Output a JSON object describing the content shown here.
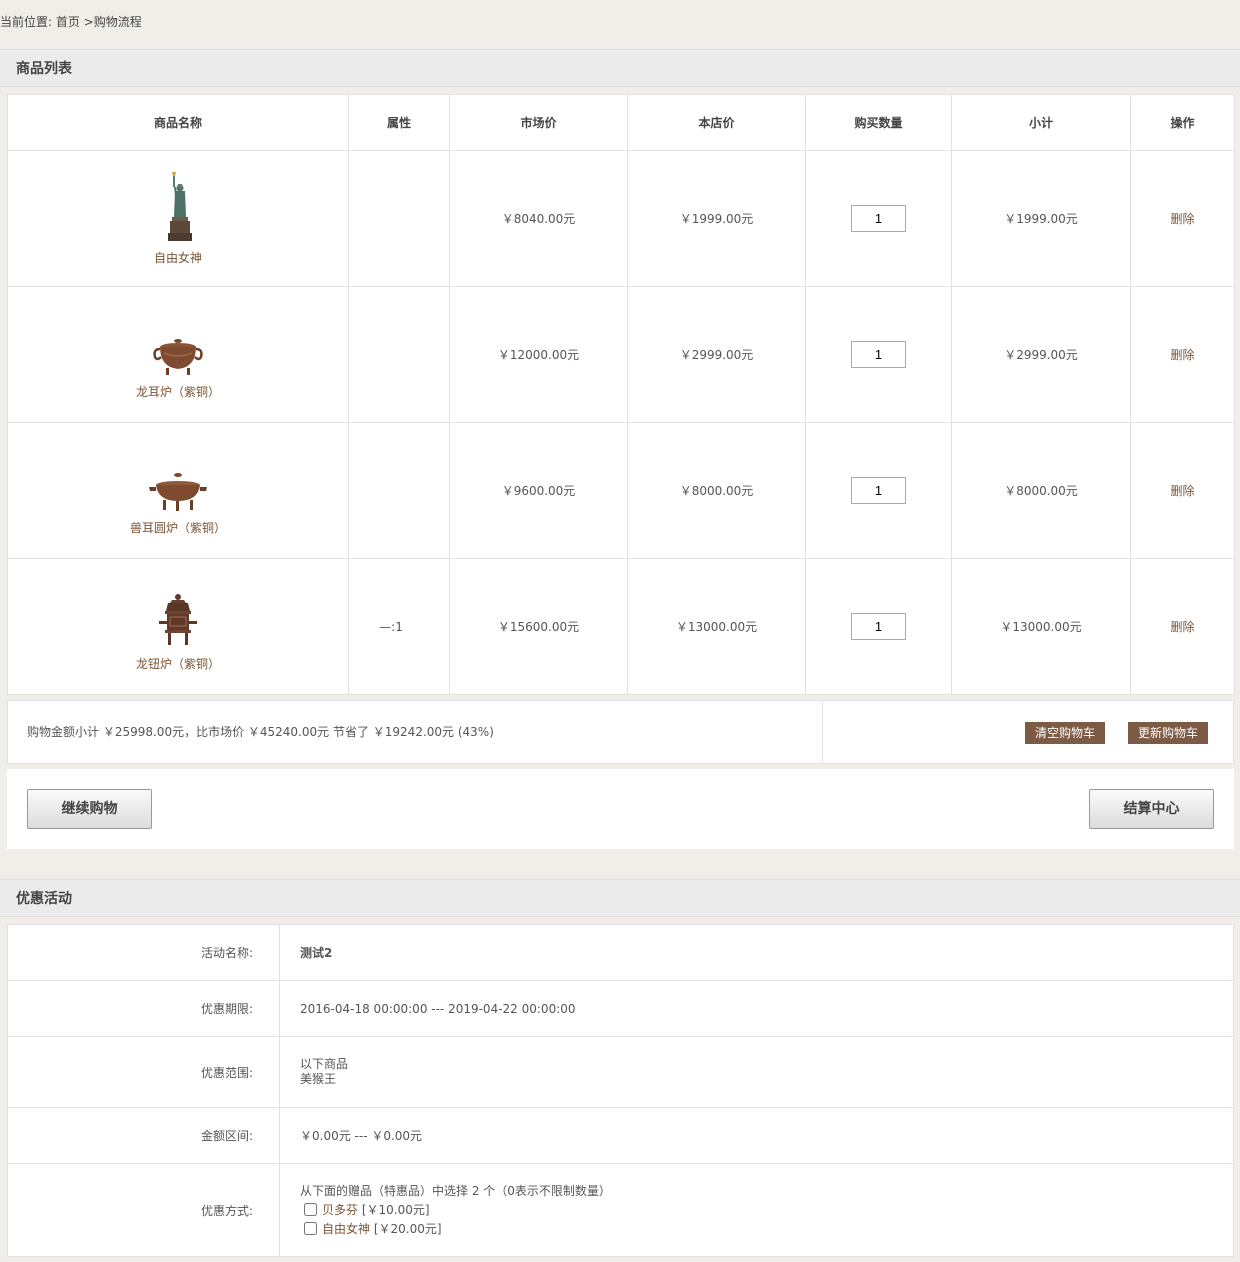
{
  "breadcrumb": {
    "prefix": "当前位置:",
    "home": "首页",
    "separator": ">",
    "current": "购物流程"
  },
  "product_section": {
    "title": "商品列表",
    "columns": [
      "商品名称",
      "属性",
      "市场价",
      "本店价",
      "购买数量",
      "小计",
      "操作"
    ],
    "rows": [
      {
        "name": "自由女神",
        "icon": "statue-of-liberty",
        "attr": "",
        "market_price": "￥8040.00元",
        "shop_price": "￥1999.00元",
        "qty": "1",
        "subtotal": "￥1999.00元",
        "action": "删除"
      },
      {
        "name": "龙耳炉（紫铜）",
        "icon": "dragon-ear-censer",
        "attr": "",
        "market_price": "￥12000.00元",
        "shop_price": "￥2999.00元",
        "qty": "1",
        "subtotal": "￥2999.00元",
        "action": "删除"
      },
      {
        "name": "兽耳圆炉（紫铜）",
        "icon": "beast-ear-round-censer",
        "attr": "",
        "market_price": "￥9600.00元",
        "shop_price": "￥8000.00元",
        "qty": "1",
        "subtotal": "￥8000.00元",
        "action": "删除"
      },
      {
        "name": "龙钮炉（紫铜）",
        "icon": "dragon-knob-censer",
        "attr": "—:1",
        "market_price": "￥15600.00元",
        "shop_price": "￥13000.00元",
        "qty": "1",
        "subtotal": "￥13000.00元",
        "action": "删除"
      }
    ]
  },
  "summary": {
    "text": "购物金额小计 ￥25998.00元，比市场价 ￥45240.00元 节省了 ￥19242.00元 (43%)",
    "clear_label": "清空购物车",
    "update_label": "更新购物车"
  },
  "actions": {
    "continue_label": "继续购物",
    "checkout_label": "结算中心"
  },
  "promo_section": {
    "title": "优惠活动",
    "name_label": "活动名称:",
    "name_value": "测试2",
    "period_label": "优惠期限:",
    "period_value": "2016-04-18 00:00:00 --- 2019-04-22 00:00:00",
    "scope_label": "优惠范围:",
    "scope_line1": "以下商品",
    "scope_line2": "美猴王",
    "amount_label": "金额区间:",
    "amount_value": "￥0.00元 --- ￥0.00元",
    "method_label": "优惠方式:",
    "method_text": "从下面的赠品（特惠品）中选择 2 个（0表示不限制数量）",
    "gifts": [
      {
        "name": "贝多芬",
        "price": "[￥10.00元]"
      },
      {
        "name": "自由女神",
        "price": "[￥20.00元]"
      }
    ]
  },
  "colors": {
    "page_bg": "#f1eee9",
    "button_brown": "#7d5a44",
    "link_brown": "#7a5434"
  }
}
